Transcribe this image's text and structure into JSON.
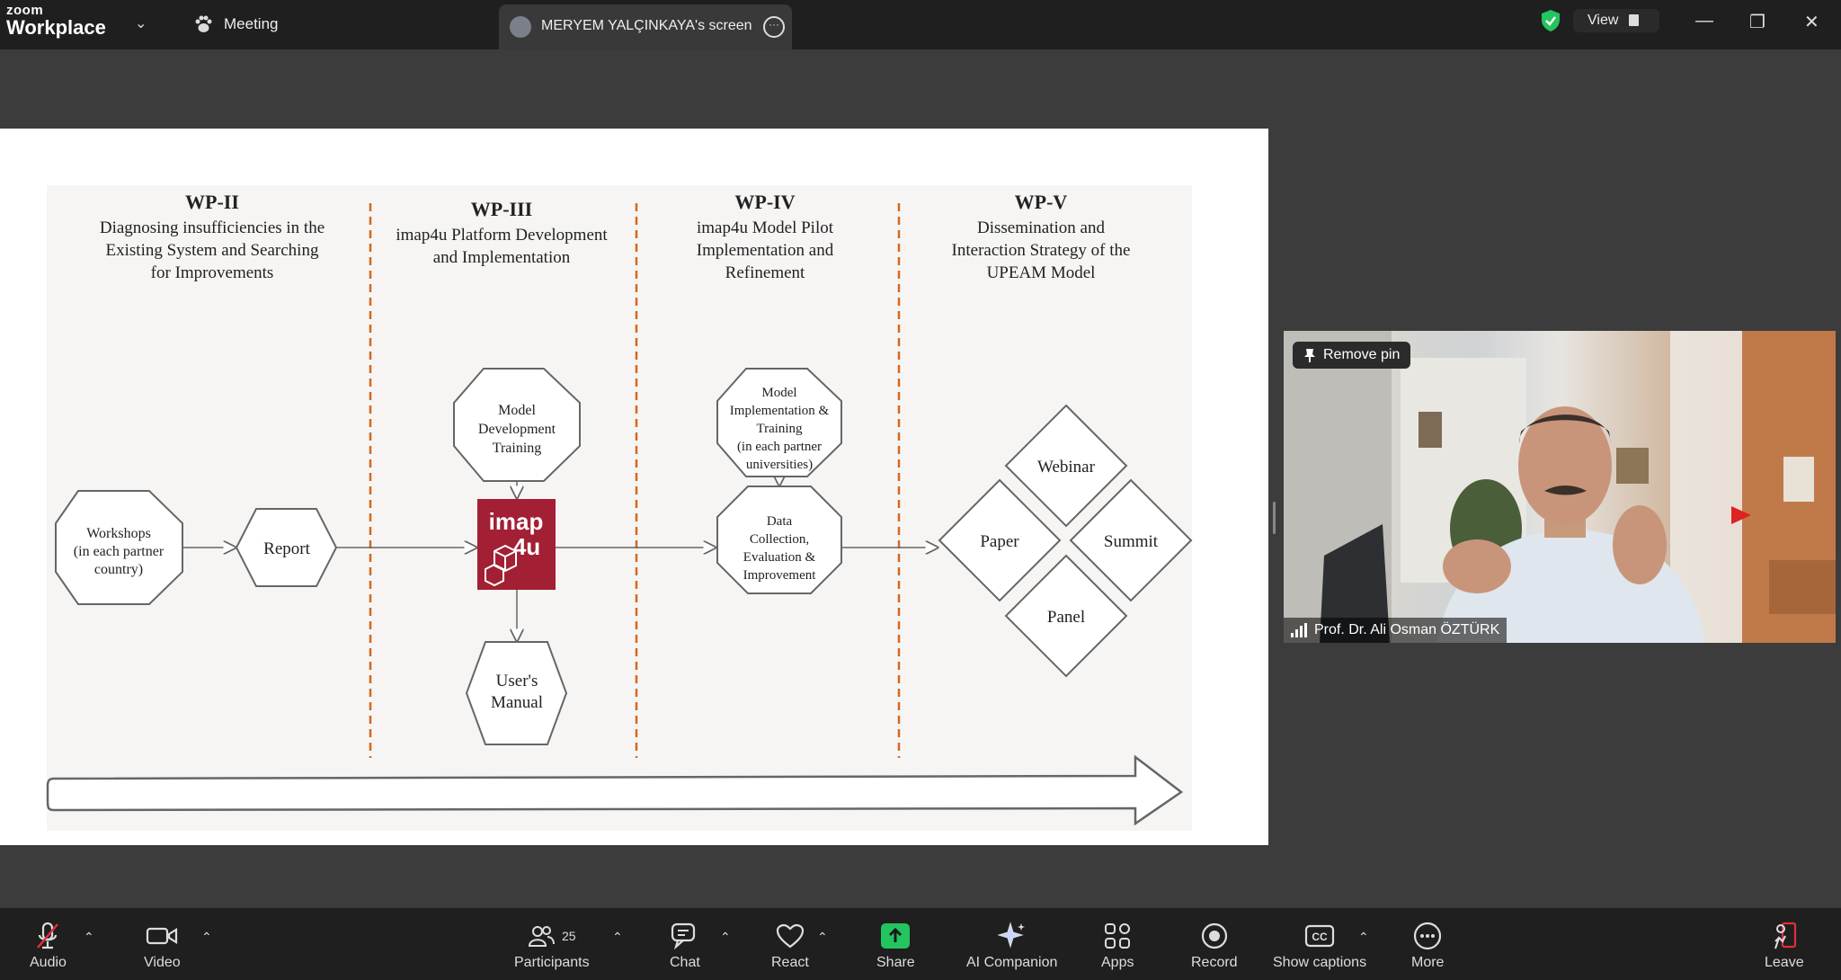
{
  "topbar": {
    "brand_small": "zoom",
    "brand_large": "Workplace",
    "meeting_label": "Meeting",
    "screen_tab_label": "MERYEM YALÇINKAYA's screen",
    "view_label": "View"
  },
  "slide": {
    "columns": [
      {
        "heading": "WP-II",
        "lines": [
          "Diagnosing insufficiencies in the",
          "Existing System and Searching",
          "for Improvements"
        ]
      },
      {
        "heading": "WP-III",
        "lines": [
          "imap4u Platform Development",
          "and Implementation"
        ]
      },
      {
        "heading": "WP-IV",
        "lines": [
          "imap4u Model Pilot",
          "Implementation and",
          "Refinement"
        ]
      },
      {
        "heading": "WP-V",
        "lines": [
          "Dissemination and",
          "Interaction Strategy of the",
          "UPEAM Model"
        ]
      }
    ],
    "nodes": {
      "workshops": [
        "Workshops",
        "(in each partner",
        "country)"
      ],
      "report": [
        "Report"
      ],
      "model_dev": [
        "Model",
        "Development",
        "Training"
      ],
      "logo_top": "imap",
      "logo_bottom": "4u",
      "user_manual": [
        "User's",
        "Manual"
      ],
      "model_impl": [
        "Model",
        "Implementation &",
        "Training",
        "(in each partner",
        "universities)"
      ],
      "data_collection": [
        "Data",
        "Collection,",
        "Evaluation &",
        "Improvement"
      ],
      "webinar": "Webinar",
      "paper": "Paper",
      "summit": "Summit",
      "panel": "Panel"
    },
    "colors": {
      "dashed_divider": "#d2691e",
      "logo_bg": "#a31f34"
    }
  },
  "video": {
    "pin_label": "Remove pin",
    "participant_name": "Prof. Dr. Ali Osman ÖZTÜRK"
  },
  "toolbar": {
    "audio": "Audio",
    "video": "Video",
    "participants": "Participants",
    "participants_count": "25",
    "chat": "Chat",
    "react": "React",
    "share": "Share",
    "ai_companion": "AI Companion",
    "apps": "Apps",
    "record": "Record",
    "captions": "Show captions",
    "more": "More",
    "leave": "Leave",
    "colors": {
      "share_green": "#23c55e",
      "leave_red": "#e02e3a"
    }
  }
}
